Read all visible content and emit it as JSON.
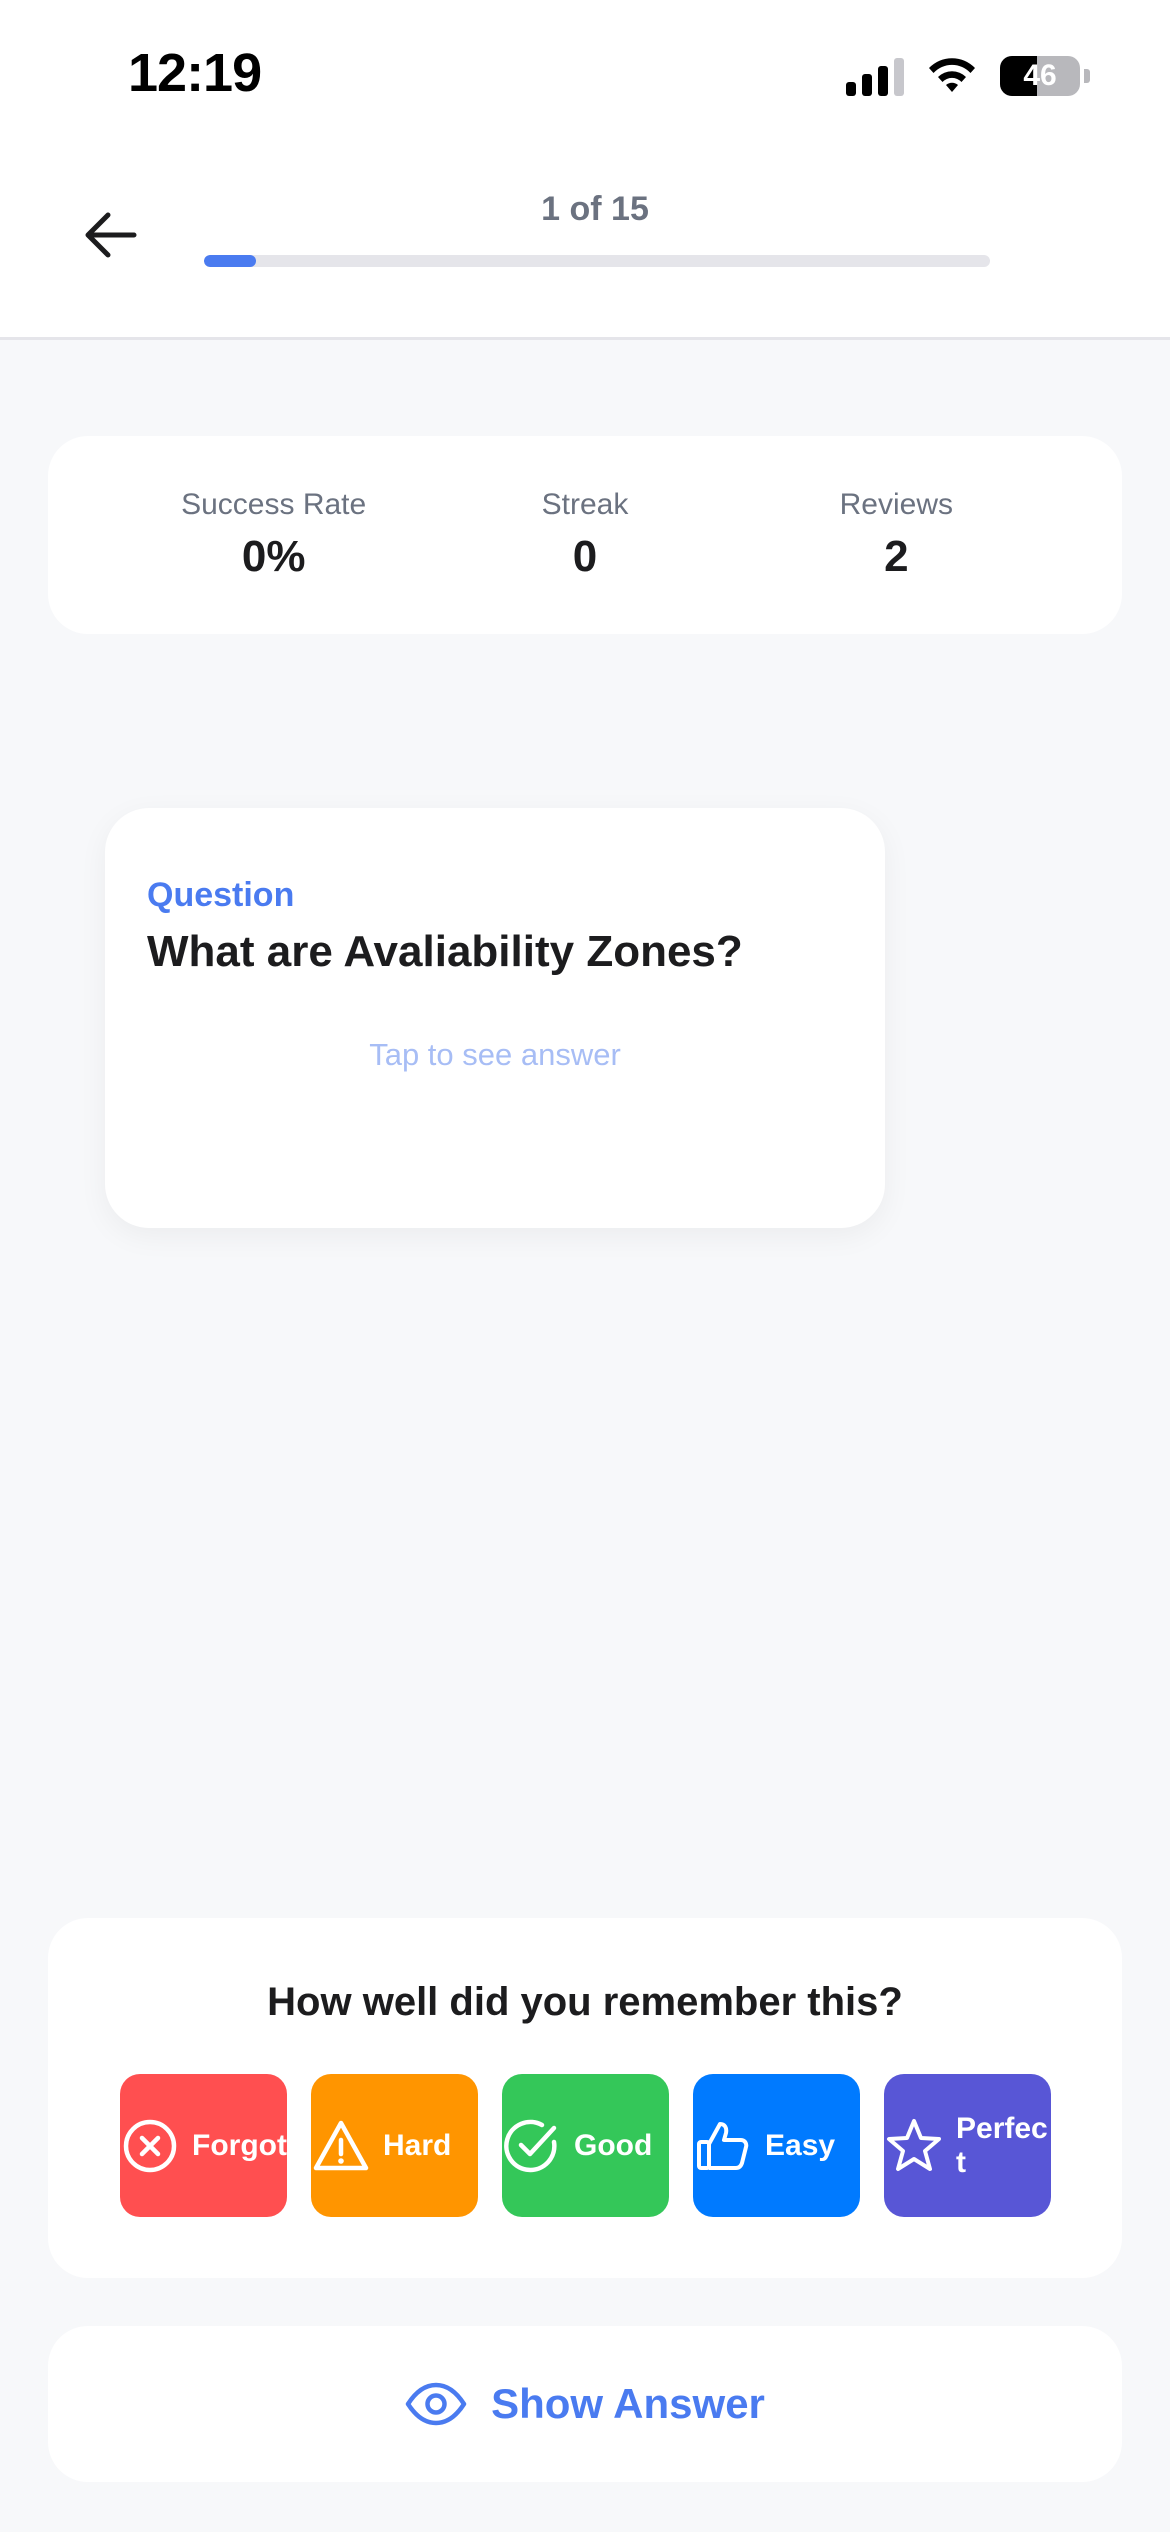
{
  "status_bar": {
    "time": "12:19",
    "battery_percent": "46",
    "battery_level": 0.46,
    "signal_bars_active": 3,
    "signal_bars_total": 4
  },
  "header": {
    "progress_text": "1 of 15",
    "progress_current": 1,
    "progress_total": 15,
    "back_icon": "arrow-left-icon"
  },
  "stats": [
    {
      "label": "Success Rate",
      "value": "0%"
    },
    {
      "label": "Streak",
      "value": "0"
    },
    {
      "label": "Reviews",
      "value": "2"
    }
  ],
  "card": {
    "label": "Question",
    "question": "What are Avaliability Zones?",
    "hint": "Tap to see answer"
  },
  "rating": {
    "title": "How well did you remember this?",
    "buttons": [
      {
        "label": "Forgot",
        "icon": "x-circle-icon",
        "color": "#FF4F50"
      },
      {
        "label": "Hard",
        "icon": "warning-triangle-icon",
        "color": "#FF9500"
      },
      {
        "label": "Good",
        "icon": "check-circle-icon",
        "color": "#34C759"
      },
      {
        "label": "Easy",
        "icon": "thumbs-up-icon",
        "color": "#007AFF"
      },
      {
        "label": "Perfect",
        "icon": "star-icon",
        "color": "#5856D6"
      }
    ]
  },
  "show_answer": {
    "label": "Show Answer",
    "icon": "eye-icon"
  },
  "colors": {
    "accent": "#4A7BF0",
    "background": "#F7F8FA"
  }
}
